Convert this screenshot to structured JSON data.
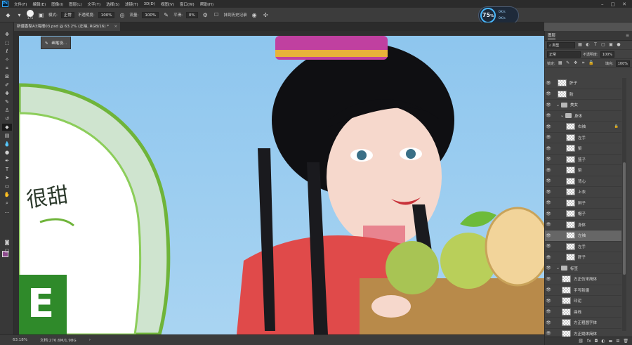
{
  "menubar": {
    "items": [
      "文件(F)",
      "编辑(E)",
      "图像(I)",
      "图层(L)",
      "文字(Y)",
      "选择(S)",
      "滤镜(T)",
      "3D(D)",
      "视图(V)",
      "窗口(W)",
      "帮助(H)"
    ]
  },
  "options": {
    "brush_size": "175",
    "mode_label": "模式:",
    "mode_value": "正常",
    "opacity_label": "不透明度:",
    "opacity_value": "100%",
    "flow_label": "流量:",
    "flow_value": "100%",
    "smooth_label": "平滑:",
    "smooth_value": "0%",
    "history_label": "抹到历史记录"
  },
  "gauge": {
    "percent": "75",
    "up": "0K/s",
    "down": "0K/s"
  },
  "document": {
    "tab_title": "新疆香梨A3海报03.psd @ 63.2% (左袖, RGB/16) *"
  },
  "tooltip": {
    "text": "画笔设..."
  },
  "statusbar": {
    "zoom": "63.18%",
    "doc_size": "文档:276.6M/1.98G"
  },
  "layers_panel": {
    "title": "图层",
    "filter_kind": "类型",
    "blend_mode": "正常",
    "opacity_label": "不透明度:",
    "opacity_value": "100%",
    "lock_label": "锁定:",
    "fill_label": "填充:",
    "fill_value": "100%",
    "layers": [
      {
        "name": "肝子",
        "type": "layer",
        "indent": 1
      },
      {
        "name": "脸",
        "type": "layer",
        "indent": 1
      },
      {
        "name": "美女",
        "type": "group",
        "indent": 1
      },
      {
        "name": "身体",
        "type": "group",
        "indent": 2
      },
      {
        "name": "右袖",
        "type": "layer",
        "indent": 3,
        "locked": true
      },
      {
        "name": "左手",
        "type": "layer",
        "indent": 3
      },
      {
        "name": "梨",
        "type": "layer",
        "indent": 3
      },
      {
        "name": "篮子",
        "type": "layer",
        "indent": 3
      },
      {
        "name": "梨",
        "type": "layer",
        "indent": 3
      },
      {
        "name": "背心",
        "type": "layer",
        "indent": 3
      },
      {
        "name": "上衣",
        "type": "layer",
        "indent": 3
      },
      {
        "name": "辫子",
        "type": "layer",
        "indent": 3
      },
      {
        "name": "帽子",
        "type": "layer",
        "indent": 3
      },
      {
        "name": "身体",
        "type": "layer",
        "indent": 3
      },
      {
        "name": "左袖",
        "type": "layer",
        "indent": 3,
        "selected": true
      },
      {
        "name": "左手",
        "type": "layer",
        "indent": 3
      },
      {
        "name": "肝子",
        "type": "layer",
        "indent": 3
      },
      {
        "name": "标签",
        "type": "group",
        "indent": 1
      },
      {
        "name": "方正仿宋简体",
        "type": "layer",
        "indent": 2
      },
      {
        "name": "手写新疆",
        "type": "layer",
        "indent": 2
      },
      {
        "name": "印泥",
        "type": "layer",
        "indent": 2
      },
      {
        "name": "曲线",
        "type": "layer",
        "indent": 2
      },
      {
        "name": "方正粗圆字体",
        "type": "layer",
        "indent": 2
      },
      {
        "name": "方正姚体简体",
        "type": "layer",
        "indent": 2
      }
    ]
  },
  "artwork": {
    "slogan": "很甜",
    "big_char": "E"
  },
  "colors": {
    "accent": "#31a8ff",
    "foreground": "#8e4b8e",
    "background": "#ffffff",
    "sky": "#9ccdef",
    "poster_green": "#2f8a2a"
  }
}
